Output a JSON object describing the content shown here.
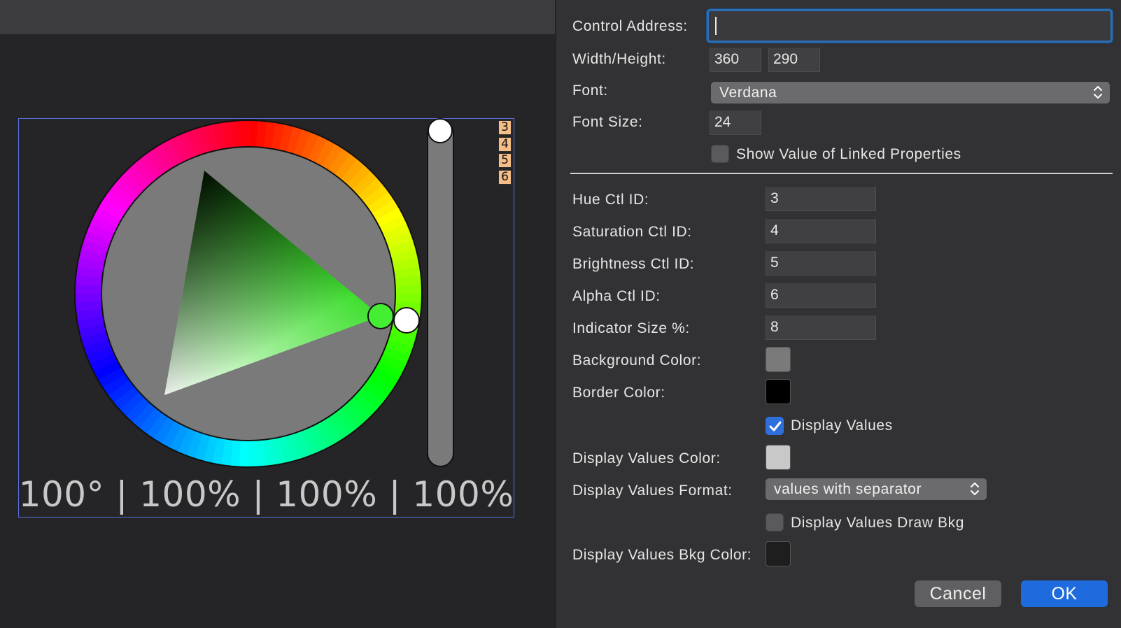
{
  "canvas": {
    "control_ids": [
      "3",
      "4",
      "5",
      "6"
    ],
    "readout": "100° | 100% | 100% | 100%",
    "colors": {
      "selection_border": "#5a6fe0",
      "background": "#808080",
      "selected_color": "#44ee33"
    }
  },
  "dialog": {
    "control_address": {
      "label": "Control Address:",
      "value": ""
    },
    "width_height": {
      "label": "Width/Height:",
      "width": "360",
      "height": "290"
    },
    "font": {
      "label": "Font:",
      "value": "Verdana"
    },
    "font_size": {
      "label": "Font Size:",
      "value": "24"
    },
    "show_linked": {
      "label": "Show Value of Linked Properties",
      "checked": false
    },
    "hue_ctl": {
      "label": "Hue Ctl ID:",
      "value": "3"
    },
    "saturation_ctl": {
      "label": "Saturation Ctl ID:",
      "value": "4"
    },
    "brightness_ctl": {
      "label": "Brightness Ctl ID:",
      "value": "5"
    },
    "alpha_ctl": {
      "label": "Alpha Ctl ID:",
      "value": "6"
    },
    "indicator_size": {
      "label": "Indicator Size %:",
      "value": "8"
    },
    "background_color": {
      "label": "Background Color:",
      "color": "#7a7a7a"
    },
    "border_color": {
      "label": "Border Color:",
      "color": "#000000"
    },
    "display_values": {
      "label": "Display Values",
      "checked": true
    },
    "display_values_color": {
      "label": "Display Values Color:",
      "color": "#c8c8c8"
    },
    "display_values_format": {
      "label": "Display Values Format:",
      "value": "values with separator"
    },
    "display_values_draw_bkg": {
      "label": "Display Values Draw Bkg",
      "checked": false
    },
    "display_values_bkg_color": {
      "label": "Display Values Bkg Color:",
      "color": "#1e1e1e"
    },
    "buttons": {
      "cancel": "Cancel",
      "ok": "OK"
    },
    "accent": "#1d6bdc"
  }
}
